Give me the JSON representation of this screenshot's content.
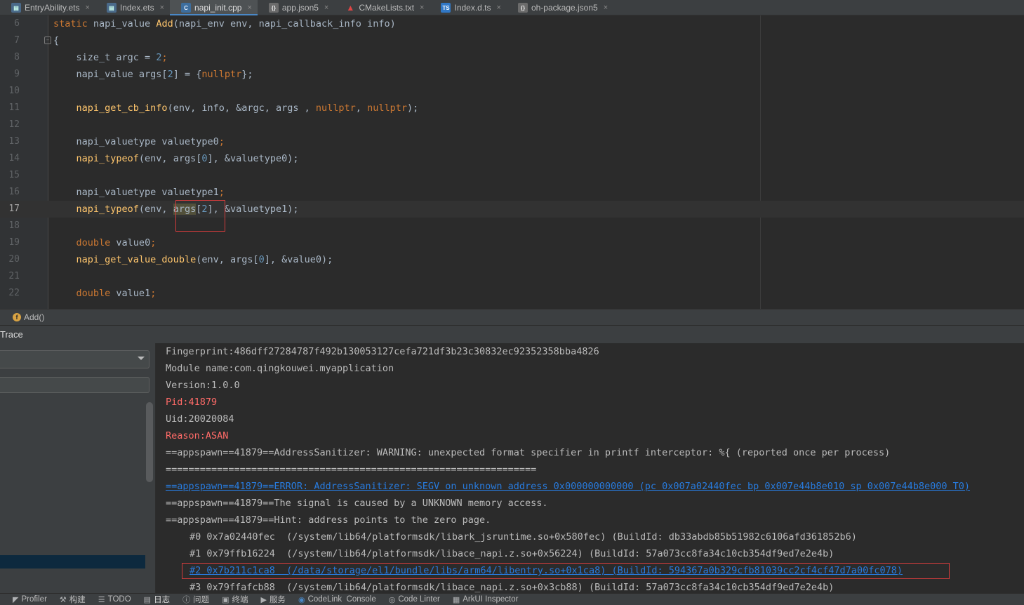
{
  "tabs": [
    {
      "label": "EntryAbility.ets",
      "icon": "ets-file-icon",
      "active": false
    },
    {
      "label": "Index.ets",
      "icon": "ets-file-icon",
      "active": false
    },
    {
      "label": "napi_init.cpp",
      "icon": "cpp-file-icon",
      "active": true
    },
    {
      "label": "app.json5",
      "icon": "json5-file-icon",
      "active": false
    },
    {
      "label": "CMakeLists.txt",
      "icon": "cmake-file-icon",
      "active": false
    },
    {
      "label": "Index.d.ts",
      "icon": "ts-file-icon",
      "active": false
    },
    {
      "label": "oh-package.json5",
      "icon": "json5-file-icon",
      "active": false
    }
  ],
  "tab_close_glyph": "×",
  "editor": {
    "current_line": "17",
    "line_numbers": [
      "6",
      "7",
      "8",
      "9",
      "10",
      "11",
      "12",
      "13",
      "14",
      "15",
      "16",
      "17",
      "18",
      "19",
      "20",
      "21",
      "22"
    ],
    "code": {
      "l6": {
        "kw": "static",
        "t1": " napi_value ",
        "fn": "Add",
        "t2": "(napi_env env, napi_callback_info info)"
      },
      "l7": {
        "t": "{"
      },
      "l8": {
        "t1": "    size_t argc = ",
        "num": "2",
        "semi": ";"
      },
      "l9": {
        "t1": "    napi_value args[",
        "num": "2",
        "t2": "] = {",
        "kw": "nullptr",
        "t3": "};"
      },
      "l11": {
        "fn": "napi_get_cb_info",
        "t1": "(env, info, &argc, args , ",
        "kw1": "nullptr",
        "c1": ", ",
        "kw2": "nullptr",
        "t2": ");"
      },
      "l13": {
        "t1": "    napi_valuetype valuetype0",
        "semi": ";"
      },
      "l14": {
        "fn": "napi_typeof",
        "t1": "(env, args[",
        "num": "0",
        "t2": "], &valuetype0);"
      },
      "l16": {
        "t1": "    napi_valuetype valuetype1",
        "semi": ";"
      },
      "l17": {
        "fn": "napi_typeof",
        "t1": "(env, ",
        "hl": "args",
        "t2": "[",
        "num": "2",
        "t3": "], &valuetype1);"
      },
      "l19": {
        "kw": "double",
        "t1": " value0",
        "semi": ";"
      },
      "l20": {
        "fn": "napi_get_value_double",
        "t1": "(env, args[",
        "num": "0",
        "t2": "], &value0);"
      },
      "l22": {
        "kw": "double",
        "t1": " value1",
        "semi": ";"
      }
    }
  },
  "breadcrumb": {
    "label": "Add()",
    "icon": "function-icon"
  },
  "tool_window": {
    "title": "Trace"
  },
  "log": {
    "lines": [
      "Fingerprint:486dff27284787f492b130053127cefa721df3b23c30832ec92352358bba4826",
      "Module name:com.qingkouwei.myapplication",
      "Version:1.0.0",
      "Pid:41879",
      "Uid:20020084",
      "Reason:ASAN",
      "==appspawn==41879==AddressSanitizer: WARNING: unexpected format specifier in printf interceptor: %{ (reported once per process)",
      "=================================================================",
      "==appspawn==41879==ERROR: AddressSanitizer: SEGV on unknown address 0x000000000000 (pc 0x007a02440fec bp 0x007e44b8e010 sp 0x007e44b8e000 T0)",
      "==appspawn==41879==The signal is caused by a UNKNOWN memory access.",
      "==appspawn==41879==Hint: address points to the zero page.",
      "#0 0x7a02440fec  (/system/lib64/platformsdk/libark_jsruntime.so+0x580fec) (BuildId: db33abdb85b51982c6106afd361852b6)",
      "#1 0x79ffb16224  (/system/lib64/platformsdk/libace_napi.z.so+0x56224) (BuildId: 57a073cc8fa34c10cb354df9ed7e2e4b)",
      "#2 0x7b211c1ca8  (/data/storage/el1/bundle/libs/arm64/libentry.so+0x1ca8) (BuildId: 594367a0b329cfb81039cc2cf4cf47d7a00fc078)",
      "#3 0x79ffafcb88  (/system/lib64/platformsdk/libace_napi.z.so+0x3cb88) (BuildId: 57a073cc8fa34c10cb354df9ed7e2e4b)"
    ]
  },
  "bottom_bar": [
    {
      "label": "Profiler",
      "icon": "profiler-icon",
      "glyph": "◤",
      "active": false
    },
    {
      "label": "构建",
      "icon": "hammer-icon",
      "glyph": "⚒",
      "active": false
    },
    {
      "label": "TODO",
      "icon": "list-icon",
      "glyph": "☰",
      "active": false
    },
    {
      "label": "日志",
      "icon": "log-icon",
      "glyph": "▤",
      "active": true
    },
    {
      "label": "问题",
      "icon": "info-icon",
      "glyph": "ⓘ",
      "active": false
    },
    {
      "label": "终端",
      "icon": "terminal-icon",
      "glyph": "▣",
      "active": false
    },
    {
      "label": "服务",
      "icon": "play-icon",
      "glyph": "▶",
      "active": false
    },
    {
      "label": "CodeLink  Console",
      "icon": "codelink-icon",
      "glyph": "◉",
      "active": false
    },
    {
      "label": "Code Linter",
      "icon": "linter-icon",
      "glyph": "◎",
      "active": false
    },
    {
      "label": "ArkUI Inspector",
      "icon": "inspector-icon",
      "glyph": "▦",
      "active": false
    }
  ],
  "colors": {
    "keyword": "#cc7832",
    "function": "#ffc66d",
    "number": "#6897bb",
    "error_text": "#ff6b68",
    "link": "#287bde",
    "highlight_box": "#d13c3c"
  }
}
